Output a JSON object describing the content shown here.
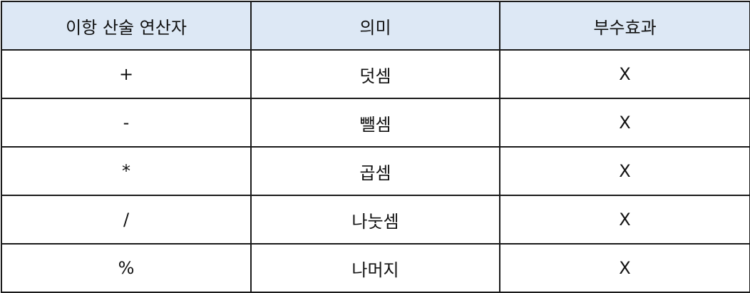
{
  "table": {
    "headers": [
      "이항 산술 연산자",
      "의미",
      "부수효과"
    ],
    "rows": [
      [
        "+",
        "덧셈",
        "X"
      ],
      [
        "-",
        "뺄셈",
        "X"
      ],
      [
        "*",
        "곱셈",
        "X"
      ],
      [
        "/",
        "나눗셈",
        "X"
      ],
      [
        "%",
        "나머지",
        "X"
      ]
    ],
    "header_background": "#dde8f5",
    "border_color": "#1a1a1a"
  }
}
